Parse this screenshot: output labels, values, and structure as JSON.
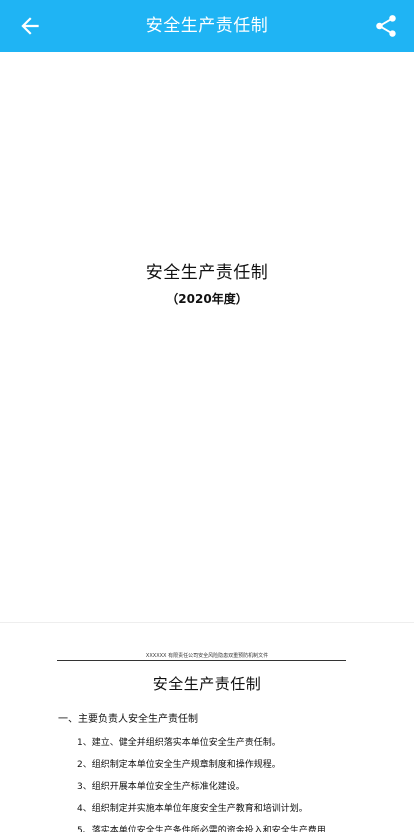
{
  "app_bar": {
    "title": "安全生产责任制",
    "back_icon": "arrow-left-icon",
    "share_icon": "share-icon",
    "color": "#1fb4f4"
  },
  "document": {
    "cover": {
      "title": "安全生产责任制",
      "year": "（2020年度）"
    },
    "page2": {
      "header_note": "XXXXXX 有限责任公司安全风险隐患双重预防机制文件",
      "title": "安全生产责任制",
      "section": "一、主要负责人安全生产责任制",
      "items": [
        "1、建立、健全并组织落实本单位安全生产责任制。",
        "2、组织制定本单位安全生产规章制度和操作规程。",
        "3、组织开展本单位安全生产标准化建设。",
        "4、组织制定并实施本单位年度安全生产教育和培训计划。",
        "5、落实本单位安全生产条件所必需的资金投入和安全生产费用"
      ]
    }
  }
}
